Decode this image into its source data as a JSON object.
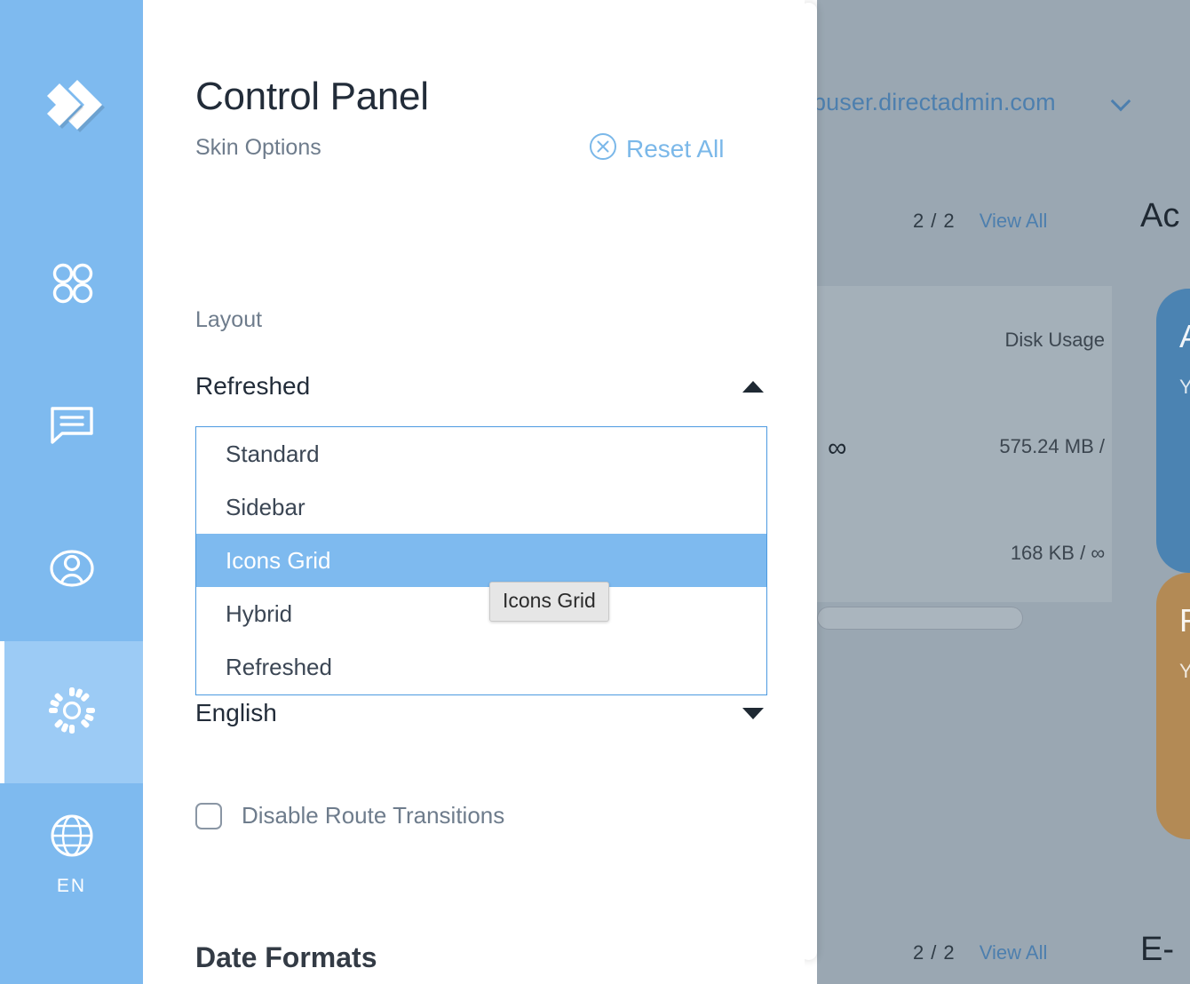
{
  "rail": {
    "logo_icon": "directadmin-logo-icon",
    "items": [
      {
        "icon": "apps-grid-icon",
        "name": "sidebar-item-apps",
        "label": "",
        "active": false
      },
      {
        "icon": "chat-icon",
        "name": "sidebar-item-messages",
        "label": "",
        "active": false
      },
      {
        "icon": "user-icon",
        "name": "sidebar-item-account",
        "label": "",
        "active": false
      },
      {
        "icon": "gear-icon",
        "name": "sidebar-item-settings",
        "label": "",
        "active": true
      },
      {
        "icon": "globe-icon",
        "name": "sidebar-item-language",
        "label": "EN",
        "active": false
      }
    ],
    "background_color": "#7ebaef",
    "active_color": "#9ccbf5"
  },
  "panel": {
    "title": "Control Panel",
    "subtitle": "Skin Options",
    "reset_all": {
      "label": "Reset All",
      "icon": "close-circle-icon",
      "color": "#7bb8e9"
    },
    "layout_field": {
      "label": "Layout",
      "value": "Refreshed",
      "caret": "caret-up-icon",
      "expanded": true,
      "options": [
        {
          "label": "Standard",
          "selected": false
        },
        {
          "label": "Sidebar",
          "selected": false
        },
        {
          "label": "Icons Grid",
          "selected": true
        },
        {
          "label": "Hybrid",
          "selected": false
        },
        {
          "label": "Refreshed",
          "selected": false
        }
      ],
      "highlight_color": "#7ebaef",
      "border_color": "#4c9ae0"
    },
    "language_field": {
      "value": "English",
      "caret": "caret-down-icon"
    },
    "tooltip": {
      "text": "Icons Grid"
    },
    "route_transitions": {
      "label": "Disable Route Transitions",
      "checked": false
    },
    "date_formats_heading": "Date Formats"
  },
  "backdrop": {
    "domain": "buser.directadmin.com",
    "domain_caret": "chevron-down-icon",
    "pager_top": {
      "current": "2",
      "separator": "/",
      "total": "2",
      "view_all": "View All"
    },
    "pager_bottom": {
      "current": "2",
      "separator": "/",
      "total": "2",
      "view_all": "View All"
    },
    "heading_account": "Ac",
    "heading_email": "E-",
    "stats": {
      "disk_usage_label": "Disk Usage",
      "bandwidth_infinity": "∞",
      "disk_value": "575.24 MB  /",
      "second_value": "168 KB  /  ∞"
    },
    "cards": [
      {
        "title": "A",
        "lines": "Y\nb\nC",
        "color": "#4b83b2",
        "name": "backdrop-card-blue"
      },
      {
        "title": "F",
        "lines": "Y\np",
        "color": "#b38a55",
        "name": "backdrop-card-brown"
      }
    ],
    "overlay_color": "#9aa7b2"
  }
}
